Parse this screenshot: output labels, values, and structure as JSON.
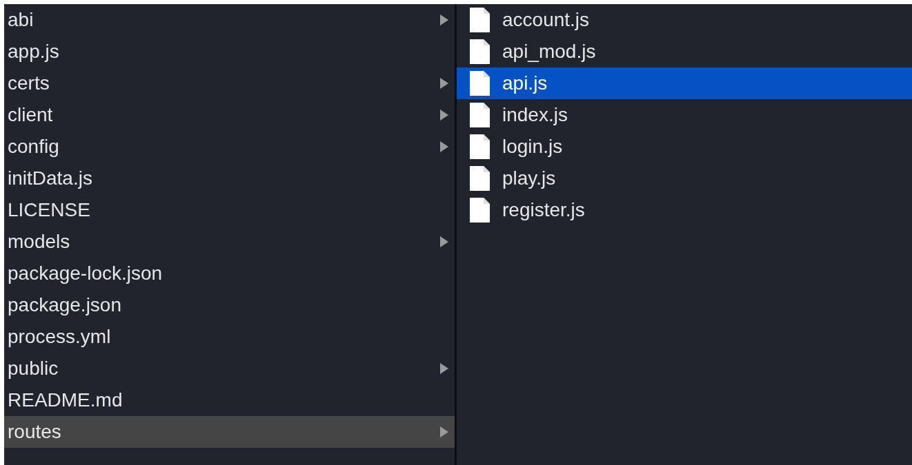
{
  "columns": [
    {
      "active": false,
      "items": [
        {
          "name": "abi",
          "kind": "folder",
          "selected": false
        },
        {
          "name": "app.js",
          "kind": "file",
          "selected": false
        },
        {
          "name": "certs",
          "kind": "folder",
          "selected": false
        },
        {
          "name": "client",
          "kind": "folder",
          "selected": false
        },
        {
          "name": "config",
          "kind": "folder",
          "selected": false
        },
        {
          "name": "initData.js",
          "kind": "file",
          "selected": false
        },
        {
          "name": "LICENSE",
          "kind": "file",
          "selected": false
        },
        {
          "name": "models",
          "kind": "folder",
          "selected": false
        },
        {
          "name": "package-lock.json",
          "kind": "file",
          "selected": false
        },
        {
          "name": "package.json",
          "kind": "file",
          "selected": false
        },
        {
          "name": "process.yml",
          "kind": "file",
          "selected": false
        },
        {
          "name": "public",
          "kind": "folder",
          "selected": false
        },
        {
          "name": "README.md",
          "kind": "file",
          "selected": false
        },
        {
          "name": "routes",
          "kind": "folder",
          "selected": true
        }
      ]
    },
    {
      "active": true,
      "items": [
        {
          "name": "account.js",
          "kind": "file",
          "selected": false
        },
        {
          "name": "api_mod.js",
          "kind": "file",
          "selected": false
        },
        {
          "name": "api.js",
          "kind": "file",
          "selected": true
        },
        {
          "name": "index.js",
          "kind": "file",
          "selected": false
        },
        {
          "name": "login.js",
          "kind": "file",
          "selected": false
        },
        {
          "name": "play.js",
          "kind": "file",
          "selected": false
        },
        {
          "name": "register.js",
          "kind": "file",
          "selected": false
        }
      ]
    }
  ]
}
